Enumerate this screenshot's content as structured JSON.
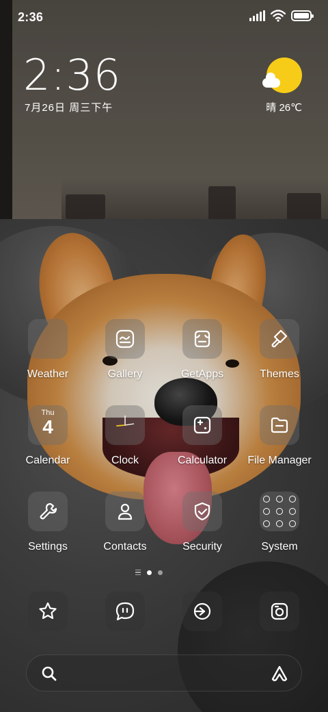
{
  "status_bar": {
    "time": "2:36",
    "icons": [
      "signal-icon",
      "wifi-icon",
      "battery-icon"
    ],
    "battery_level": 1.0
  },
  "clock_widget": {
    "time": "2:36",
    "date": "7月26日 周三下午"
  },
  "weather_widget": {
    "icon": "partly-sunny-icon",
    "text": "晴 26℃",
    "sun_color": "#f6cc18"
  },
  "apps": [
    {
      "label": "Weather",
      "icon": "weather-icon"
    },
    {
      "label": "Gallery",
      "icon": "gallery-icon"
    },
    {
      "label": "GetApps",
      "icon": "getapps-icon"
    },
    {
      "label": "Themes",
      "icon": "brush-icon"
    },
    {
      "label": "Calendar",
      "icon": "calendar-icon",
      "day": "Thu",
      "date": "4"
    },
    {
      "label": "Clock",
      "icon": "clock-icon"
    },
    {
      "label": "Calculator",
      "icon": "calculator-icon"
    },
    {
      "label": "File Manager",
      "icon": "folder-icon"
    },
    {
      "label": "Settings",
      "icon": "wrench-icon"
    },
    {
      "label": "Contacts",
      "icon": "person-icon"
    },
    {
      "label": "Security",
      "icon": "shield-check-icon"
    },
    {
      "label": "System",
      "icon": "system-folder-icon"
    }
  ],
  "page_indicator": {
    "pages": 2,
    "current": 1
  },
  "dock": [
    {
      "icon": "star-app-icon"
    },
    {
      "icon": "message-icon"
    },
    {
      "icon": "browser-icon"
    },
    {
      "icon": "camera-icon"
    }
  ],
  "search_bar": {
    "placeholder": "",
    "left_icon": "search-icon",
    "right_icon": "assistant-icon"
  }
}
